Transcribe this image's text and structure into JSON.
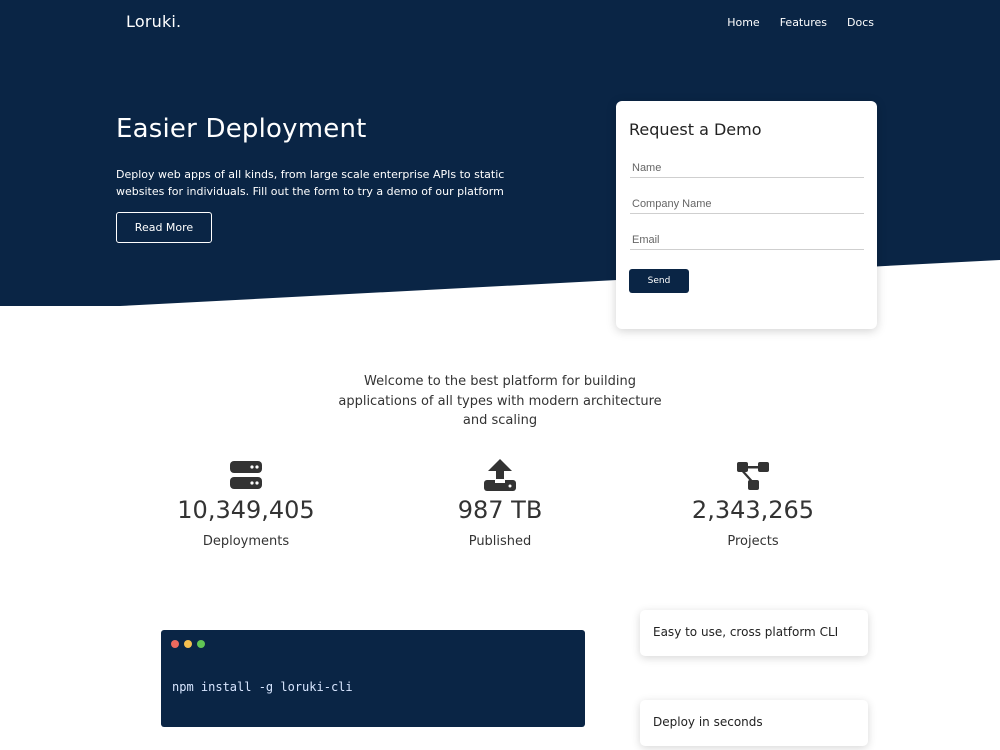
{
  "colors": {
    "primary": "#0a2545",
    "text": "#333333",
    "dot_red": "#ed6a5e",
    "dot_yellow": "#f4bf4f",
    "dot_green": "#61c554"
  },
  "nav": {
    "logo": "Loruki.",
    "links": [
      "Home",
      "Features",
      "Docs"
    ]
  },
  "hero": {
    "title": "Easier Deployment",
    "description": "Deploy web apps of all kinds, from large scale enterprise APIs to static websites for individuals. Fill out the form to try a demo of our platform",
    "button_label": "Read More"
  },
  "demo_form": {
    "title": "Request a Demo",
    "name_placeholder": "Name",
    "company_placeholder": "Company Name",
    "email_placeholder": "Email",
    "send_label": "Send"
  },
  "welcome_text": "Welcome to the best platform for building applications of all types with modern architecture and scaling",
  "stats": [
    {
      "icon": "server-icon",
      "value": "10,349,405",
      "label": "Deployments"
    },
    {
      "icon": "upload-icon",
      "value": "987 TB",
      "label": "Published"
    },
    {
      "icon": "project-diagram-icon",
      "value": "2,343,265",
      "label": "Projects"
    }
  ],
  "terminal": {
    "command": "npm install -g loruki-cli"
  },
  "features": [
    "Easy to use, cross platform CLI",
    "Deploy in seconds"
  ]
}
